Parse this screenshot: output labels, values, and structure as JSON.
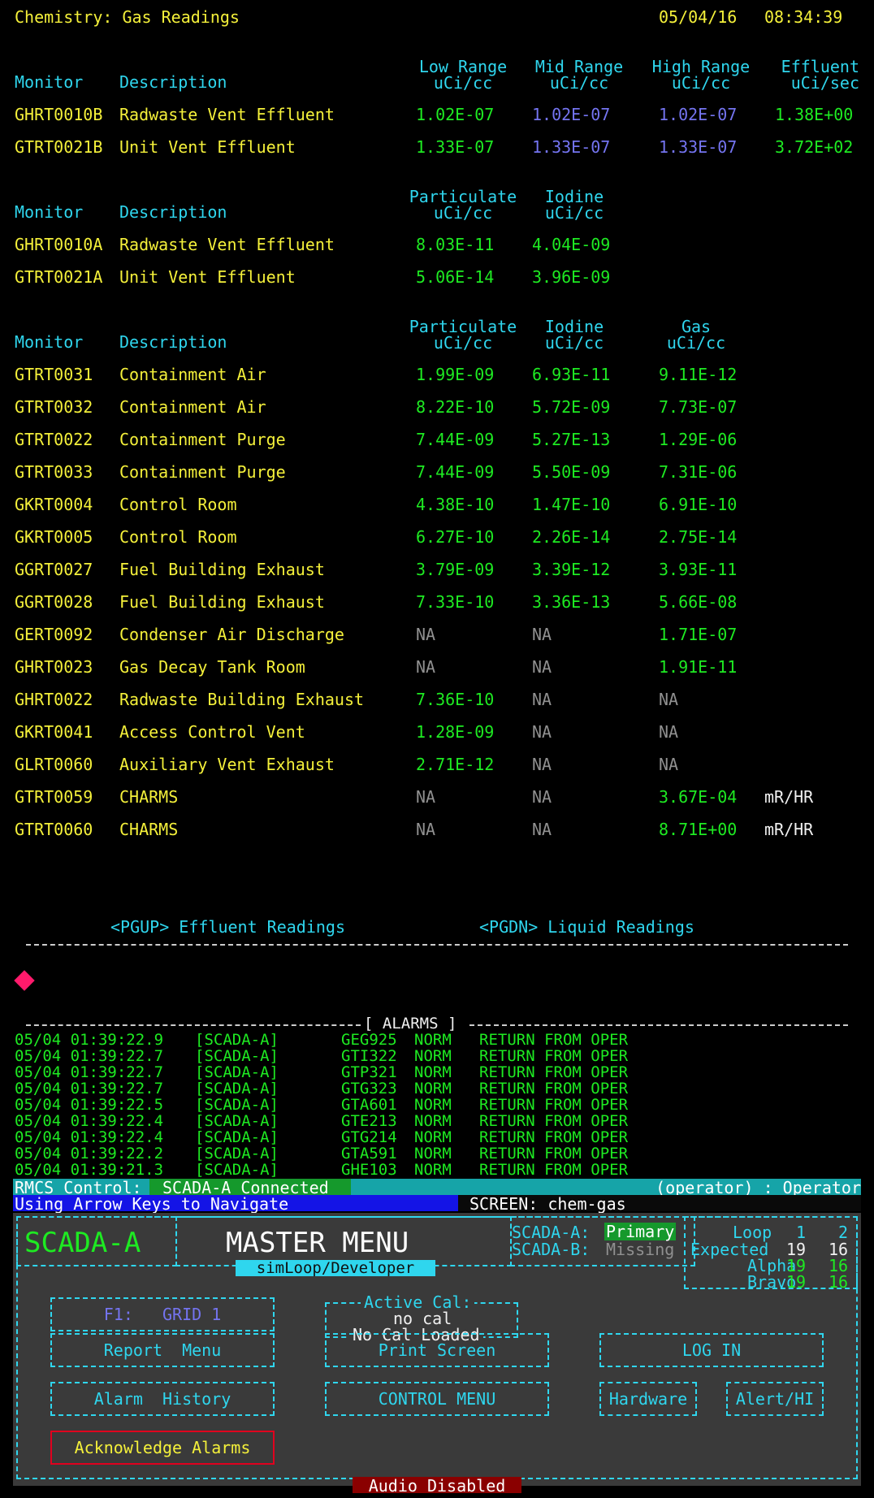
{
  "header": {
    "title": "Chemistry: Gas Readings",
    "date": "05/04/16",
    "time": "08:34:39"
  },
  "section1": {
    "col_monitor": "Monitor",
    "col_desc": "Description",
    "col_low": [
      "Low Range",
      "uCi/cc"
    ],
    "col_mid": [
      "Mid Range",
      "uCi/cc"
    ],
    "col_high": [
      "High Range",
      "uCi/cc"
    ],
    "col_eff": [
      "Effluent",
      "uCi/sec"
    ],
    "rows": [
      {
        "monitor": "GHRT0010B",
        "desc": "Radwaste Vent Effluent",
        "low": "1.02E-07",
        "mid": "1.02E-07",
        "high": "1.02E-07",
        "eff": "1.38E+00"
      },
      {
        "monitor": "GTRT0021B",
        "desc": "Unit Vent Effluent",
        "low": "1.33E-07",
        "mid": "1.33E-07",
        "high": "1.33E-07",
        "eff": "3.72E+02"
      }
    ]
  },
  "section2": {
    "col_monitor": "Monitor",
    "col_desc": "Description",
    "col_part": [
      "Particulate",
      "uCi/cc"
    ],
    "col_iod": [
      "Iodine",
      "uCi/cc"
    ],
    "rows": [
      {
        "monitor": "GHRT0010A",
        "desc": "Radwaste Vent Effluent",
        "part": "8.03E-11",
        "iod": "4.04E-09"
      },
      {
        "monitor": "GTRT0021A",
        "desc": "Unit Vent Effluent",
        "part": "5.06E-14",
        "iod": "3.96E-09"
      }
    ]
  },
  "section3": {
    "col_monitor": "Monitor",
    "col_desc": "Description",
    "col_part": [
      "Particulate",
      "uCi/cc"
    ],
    "col_iod": [
      "Iodine",
      "uCi/cc"
    ],
    "col_gas": [
      "Gas",
      "uCi/cc"
    ],
    "rows": [
      {
        "monitor": "GTRT0031",
        "desc": "Containment Air",
        "part": "1.99E-09",
        "iod": "6.93E-11",
        "gas": "9.11E-12",
        "unit": ""
      },
      {
        "monitor": "GTRT0032",
        "desc": "Containment Air",
        "part": "8.22E-10",
        "iod": "5.72E-09",
        "gas": "7.73E-07",
        "unit": ""
      },
      {
        "monitor": "GTRT0022",
        "desc": "Containment Purge",
        "part": "7.44E-09",
        "iod": "5.27E-13",
        "gas": "1.29E-06",
        "unit": ""
      },
      {
        "monitor": "GTRT0033",
        "desc": "Containment Purge",
        "part": "7.44E-09",
        "iod": "5.50E-09",
        "gas": "7.31E-06",
        "unit": ""
      },
      {
        "monitor": "GKRT0004",
        "desc": "Control Room",
        "part": "4.38E-10",
        "iod": "1.47E-10",
        "gas": "6.91E-10",
        "unit": ""
      },
      {
        "monitor": "GKRT0005",
        "desc": "Control Room",
        "part": "6.27E-10",
        "iod": "2.26E-14",
        "gas": "2.75E-14",
        "unit": ""
      },
      {
        "monitor": "GGRT0027",
        "desc": "Fuel Building Exhaust",
        "part": "3.79E-09",
        "iod": "3.39E-12",
        "gas": "3.93E-11",
        "unit": ""
      },
      {
        "monitor": "GGRT0028",
        "desc": "Fuel Building Exhaust",
        "part": "7.33E-10",
        "iod": "3.36E-13",
        "gas": "5.66E-08",
        "unit": ""
      },
      {
        "monitor": "GERT0092",
        "desc": "Condenser Air Discharge",
        "part": "NA",
        "iod": "NA",
        "gas": "1.71E-07",
        "unit": ""
      },
      {
        "monitor": "GHRT0023",
        "desc": "Gas Decay Tank Room",
        "part": "NA",
        "iod": "NA",
        "gas": "1.91E-11",
        "unit": ""
      },
      {
        "monitor": "GHRT0022",
        "desc": "Radwaste Building Exhaust",
        "part": "7.36E-10",
        "iod": "NA",
        "gas": "NA",
        "unit": ""
      },
      {
        "monitor": "GKRT0041",
        "desc": "Access Control Vent",
        "part": "1.28E-09",
        "iod": "NA",
        "gas": "NA",
        "unit": ""
      },
      {
        "monitor": "GLRT0060",
        "desc": "Auxiliary Vent Exhaust",
        "part": "2.71E-12",
        "iod": "NA",
        "gas": "NA",
        "unit": ""
      },
      {
        "monitor": "GTRT0059",
        "desc": "CHARMS",
        "part": "NA",
        "iod": "NA",
        "gas": "3.67E-04",
        "unit": "mR/HR"
      },
      {
        "monitor": "GTRT0060",
        "desc": "CHARMS",
        "part": "NA",
        "iod": "NA",
        "gas": "8.71E+00",
        "unit": "mR/HR"
      }
    ]
  },
  "nav": {
    "pgup": "<PGUP> Effluent Readings",
    "pgdn": "<PGDN> Liquid Readings"
  },
  "alarms": {
    "title": "[ ALARMS ]",
    "rows": [
      {
        "ts": "05/04 01:39:22.9",
        "src": "[SCADA-A]",
        "tag": "GEG925",
        "state": "NORM",
        "msg": "RETURN FROM OPER"
      },
      {
        "ts": "05/04 01:39:22.7",
        "src": "[SCADA-A]",
        "tag": "GTI322",
        "state": "NORM",
        "msg": "RETURN FROM OPER"
      },
      {
        "ts": "05/04 01:39:22.7",
        "src": "[SCADA-A]",
        "tag": "GTP321",
        "state": "NORM",
        "msg": "RETURN FROM OPER"
      },
      {
        "ts": "05/04 01:39:22.7",
        "src": "[SCADA-A]",
        "tag": "GTG323",
        "state": "NORM",
        "msg": "RETURN FROM OPER"
      },
      {
        "ts": "05/04 01:39:22.5",
        "src": "[SCADA-A]",
        "tag": "GTA601",
        "state": "NORM",
        "msg": "RETURN FROM OPER"
      },
      {
        "ts": "05/04 01:39:22.4",
        "src": "[SCADA-A]",
        "tag": "GTE213",
        "state": "NORM",
        "msg": "RETURN FROM OPER"
      },
      {
        "ts": "05/04 01:39:22.4",
        "src": "[SCADA-A]",
        "tag": "GTG214",
        "state": "NORM",
        "msg": "RETURN FROM OPER"
      },
      {
        "ts": "05/04 01:39:22.2",
        "src": "[SCADA-A]",
        "tag": "GTA591",
        "state": "NORM",
        "msg": "RETURN FROM OPER"
      },
      {
        "ts": "05/04 01:39:21.3",
        "src": "[SCADA-A]",
        "tag": "GHE103",
        "state": "NORM",
        "msg": "RETURN FROM OPER"
      }
    ]
  },
  "status": {
    "rmcs_label": "RMCS Control:",
    "rmcs_value": "SCADA-A Connected",
    "operator": "(operator) : Operator",
    "hint": "Using Arrow Keys to Navigate",
    "screen": "SCREEN: chem-gas"
  },
  "menu": {
    "scada_name": "SCADA-A",
    "title": "MASTER MENU",
    "subtitle": "simLoop/Developer",
    "scada_a_label": "SCADA-A:",
    "scada_a_value": "Primary",
    "scada_b_label": "SCADA-B:",
    "scada_b_value": "Missing",
    "loop_label": "Loop",
    "loop_1": "1",
    "loop_2": "2",
    "expected_label": "Expected",
    "expected_1": "19",
    "expected_2": "16",
    "alpha_label": "Alpha",
    "alpha_1": "19",
    "alpha_2": "16",
    "bravo_label": "Bravo",
    "bravo_1": "19",
    "bravo_2": "16",
    "f1_label": "F1:   GRID 1",
    "active_cal_title": "Active Cal:",
    "active_cal_value": "no cal",
    "active_cal_status": "No Cal Loaded",
    "report_menu": "Report  Menu",
    "print_screen": "Print Screen",
    "log_in": "LOG IN",
    "alarm_history": "Alarm  History",
    "control_menu": "CONTROL MENU",
    "hardware": "Hardware",
    "alert_hi": "Alert/HI",
    "ack_alarms": "Acknowledge Alarms",
    "audio": "Audio Disabled"
  },
  "colors": {
    "bg": "#000000",
    "yellow": "#f4f03a",
    "cyan": "#2fd6ee",
    "green": "#1eea22",
    "blue": "#7474f0",
    "grey": "#909090",
    "status_teal": "#16a4a8",
    "nav_blue": "#1414e6",
    "alert_red": "#e0001e",
    "diamond": "#ff1a6b"
  }
}
